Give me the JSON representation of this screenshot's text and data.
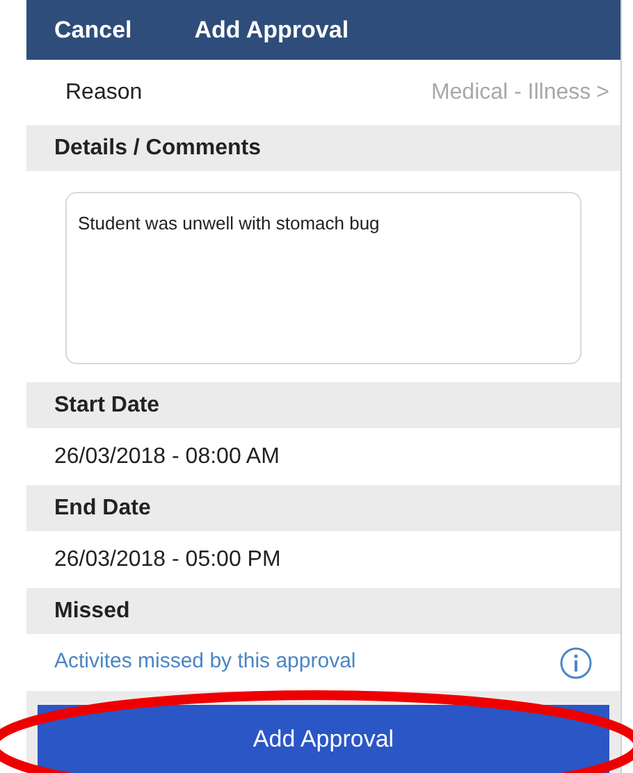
{
  "nav_bar": {
    "cancel": "Cancel",
    "title": "Add Approval"
  },
  "reason": {
    "label": "Reason",
    "value": "Medical - Illness",
    "chevron": ">"
  },
  "sections": [
    {
      "kind": "textarea",
      "header": "Details / Comments",
      "value": "Student was unwell with stomach bug"
    },
    {
      "kind": "value",
      "header": "Start Date",
      "value": "26/03/2018 - 08:00 AM"
    },
    {
      "kind": "value",
      "header": "End Date",
      "value": "26/03/2018 - 05:00 PM"
    },
    {
      "kind": "link",
      "header": "Missed",
      "value": "Activites missed by this approval"
    }
  ],
  "submit_button": "Add Approval"
}
